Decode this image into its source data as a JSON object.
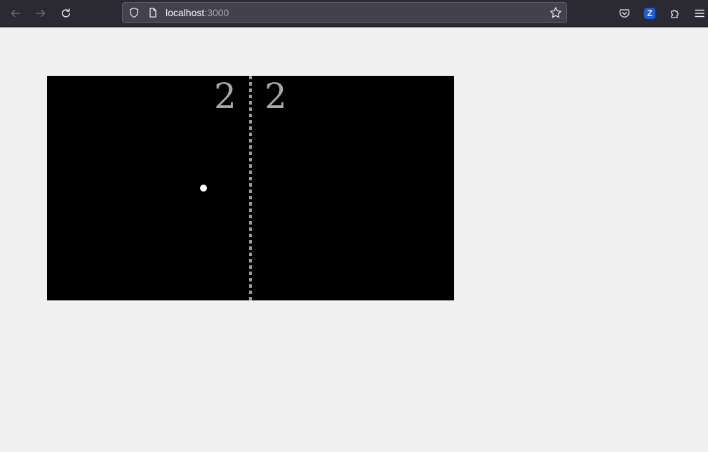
{
  "browser": {
    "url_host": "localhost",
    "url_port": ":3000",
    "icons": {
      "back": "arrow-left-icon",
      "forward": "arrow-right-icon",
      "reload": "reload-icon",
      "tracking_protection": "shield-icon",
      "page": "page-icon",
      "bookmark": "star-icon",
      "pocket": "pocket-icon",
      "extension_badge": "Z",
      "extensions": "puzzle-icon",
      "menu": "hamburger-menu-icon"
    }
  },
  "game": {
    "left_score": "2",
    "right_score": "2",
    "colors": {
      "field": "#000000",
      "net": "#9a9a9a",
      "score": "#a8a8a8",
      "ball": "#ffffff"
    }
  }
}
